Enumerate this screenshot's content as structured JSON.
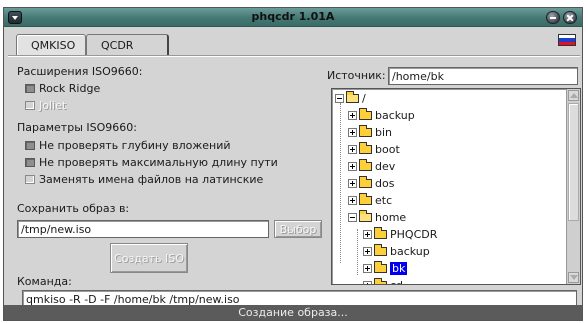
{
  "window": {
    "title": "phqcdr 1.01A"
  },
  "tabs": [
    {
      "label": "QMKISO"
    },
    {
      "label": "QCDR"
    }
  ],
  "iso_extensions": {
    "heading": "Расширения ISO9660:",
    "rock_ridge": "Rock Ridge",
    "joliet": "Joliet"
  },
  "iso_params": {
    "heading": "Параметры ISO9660:",
    "no_depth_check": "Не проверять глубину вложений",
    "no_length_check": "Не проверять максимальную длину пути",
    "latin_names": "Заменять имена файлов на латинские"
  },
  "save": {
    "label": "Сохранить образ в:",
    "path": "/tmp/new.iso",
    "browse_button": "Выбор"
  },
  "create_button": "Создать ISO",
  "command": {
    "label": "Команда:",
    "value": "qmkiso -R -D -F /home/bk /tmp/new.iso"
  },
  "source": {
    "label": "Источник:",
    "path": "/home/bk"
  },
  "tree": {
    "root": "/",
    "items": [
      "backup",
      "bin",
      "boot",
      "dev",
      "dos",
      "etc",
      "home"
    ],
    "home_children": [
      "PHQCDR",
      "backup",
      "bk",
      "cd"
    ]
  },
  "status": "Создание образа...",
  "colors": {
    "titlebar": "#457874",
    "selection": "#0000ee",
    "status_bar": "#5b5b5b"
  }
}
